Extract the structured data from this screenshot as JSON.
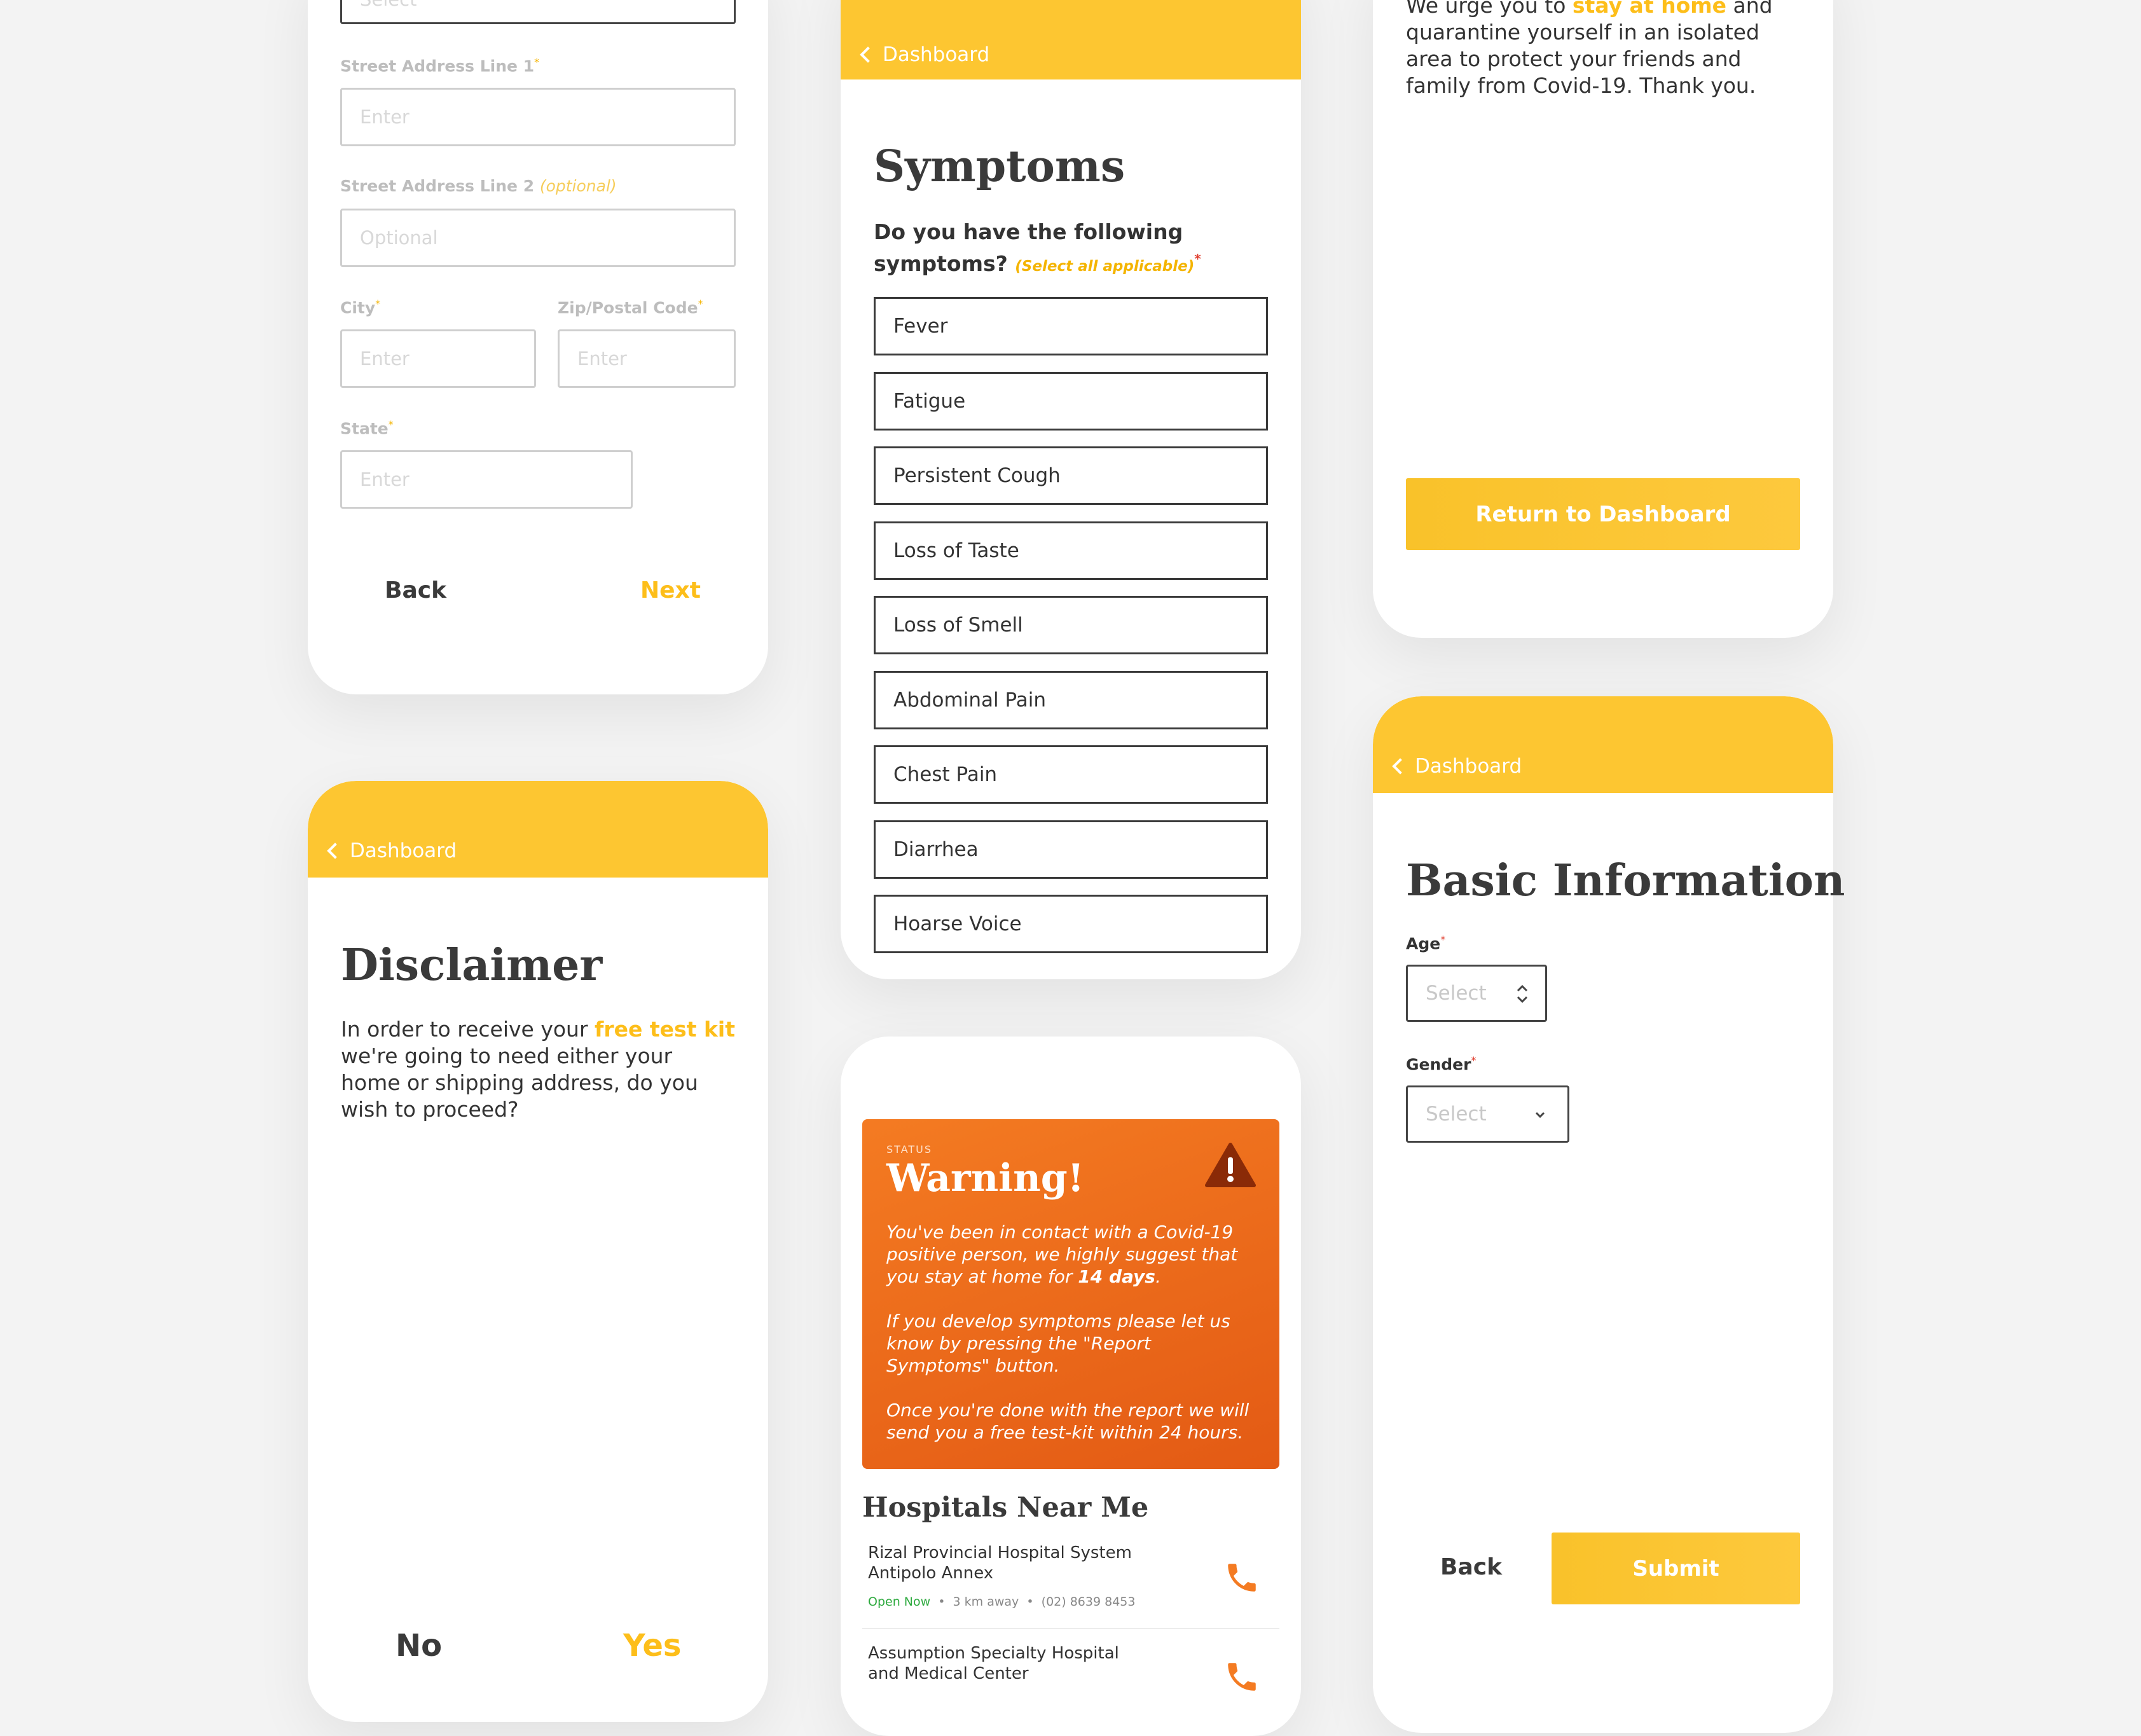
{
  "address_card": {
    "top_select_placeholder": "Select",
    "street1_label": "Street Address Line 1",
    "street1_placeholder": "Enter",
    "street2_label": "Street Address Line 2",
    "street2_optional_tag": "(optional)",
    "street2_placeholder": "Optional",
    "city_label": "City",
    "city_placeholder": "Enter",
    "zip_label": "Zip/Postal Code",
    "zip_placeholder": "Enter",
    "state_label": "State",
    "state_placeholder": "Enter",
    "back_label": "Back",
    "next_label": "Next",
    "required_mark": "*"
  },
  "disclaimer_card": {
    "back_link": "Dashboard",
    "title": "Disclaimer",
    "body_before": "In order to receive your ",
    "body_highlight": "free test kit",
    "body_after": " we're going to need either your home or shipping address, do you wish to proceed?",
    "no_label": "No",
    "yes_label": "Yes"
  },
  "symptoms_card": {
    "back_link": "Dashboard",
    "title": "Symptoms",
    "question": "Do you have the following symptoms?",
    "hint": "(Select all applicable)",
    "required_mark": "*",
    "items": [
      "Fever",
      "Fatigue",
      "Persistent Cough",
      "Loss of Taste",
      "Loss of Smell",
      "Abdominal Pain",
      "Chest Pain",
      "Diarrhea",
      "Hoarse Voice"
    ]
  },
  "status_card": {
    "status_label": "STATUS",
    "status_title": "Warning!",
    "p1_before": "You've been in contact with a Covid-19 positive person, we highly suggest that you stay at home for ",
    "p1_bold": "14 days",
    "p1_after": ".",
    "p2": "If you develop symptoms please let us know by pressing the \"Report Symptoms\" button.",
    "p3": "Once you're done with the report we will send you a free test-kit within 24 hours.",
    "hospitals_title": "Hospitals Near Me",
    "hospitals": [
      {
        "name": "Rizal Provincial Hospital System Antipolo Annex",
        "status": "Open Now",
        "distance": "3 km away",
        "phone": "(02) 8639 8453"
      },
      {
        "name": "Assumption Specialty Hospital and Medical Center"
      }
    ],
    "accent": "#f47b22"
  },
  "quarantine_card": {
    "line1_before": "We urge you to ",
    "line1_highlight": "stay at home",
    "line1_after": " and",
    "body": "quarantine yourself in an isolated area to protect your friends and family from Covid-19. Thank you.",
    "button_label": "Return to Dashboard"
  },
  "basic_info_card": {
    "back_link": "Dashboard",
    "title": "Basic Information",
    "age_label": "Age",
    "age_placeholder": "Select",
    "gender_label": "Gender",
    "gender_placeholder": "Select",
    "required_mark": "*",
    "back_label": "Back",
    "submit_label": "Submit"
  },
  "colors": {
    "brand_yellow": "#fdc631",
    "warning_orange": "#f47b22",
    "open_green": "#2eaa3f"
  }
}
